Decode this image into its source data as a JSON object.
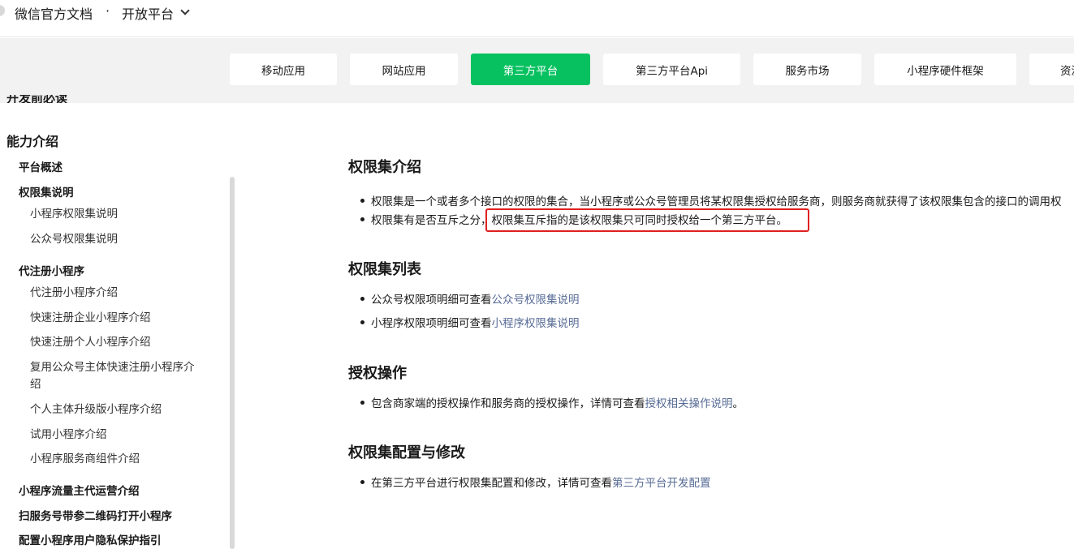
{
  "header": {
    "brand": "微信官方文档",
    "separator": "·",
    "platform_label": "开放平台"
  },
  "tabs": [
    {
      "label": "移动应用",
      "active": false
    },
    {
      "label": "网站应用",
      "active": false
    },
    {
      "label": "第三方平台",
      "active": true
    },
    {
      "label": "第三方平台Api",
      "active": false
    },
    {
      "label": "服务市场",
      "active": false
    },
    {
      "label": "小程序硬件框架",
      "active": false
    },
    {
      "label": "资源",
      "active": false
    }
  ],
  "sidebar": {
    "cut_item": "开发前必读",
    "items": [
      {
        "label": "能力介绍",
        "level": "h1"
      },
      {
        "label": "平台概述",
        "level": "h2"
      },
      {
        "label": "权限集说明",
        "level": "h2"
      },
      {
        "label": "小程序权限集说明",
        "level": "h3"
      },
      {
        "label": "公众号权限集说明",
        "level": "h3"
      },
      {
        "label": "代注册小程序",
        "level": "h2"
      },
      {
        "label": "代注册小程序介绍",
        "level": "h3"
      },
      {
        "label": "快速注册企业小程序介绍",
        "level": "h3"
      },
      {
        "label": "快速注册个人小程序介绍",
        "level": "h3"
      },
      {
        "label": "复用公众号主体快速注册小程序介",
        "level": "h3"
      },
      {
        "label": "绍",
        "level": "h3"
      },
      {
        "label": "个人主体升级版小程序介绍",
        "level": "h3"
      },
      {
        "label": "试用小程序介绍",
        "level": "h3"
      },
      {
        "label": "小程序服务商组件介绍",
        "level": "h3"
      },
      {
        "label": "小程序流量主代运营介绍",
        "level": "h2"
      },
      {
        "label": "扫服务号带参二维码打开小程序",
        "level": "h2"
      },
      {
        "label": "配置小程序用户隐私保护指引",
        "level": "h2"
      }
    ]
  },
  "content": {
    "sections": [
      {
        "title": "权限集介绍",
        "bullets": [
          {
            "text": "权限集是一个或者多个接口的权限的集合，当小程序或公众号管理员将某权限集授权给服务商，则服务商就获得了该权限集包含的接口的调用权",
            "link": ""
          },
          {
            "text": "权限集有是否互斥之分，权限集互斥指的是该权限集只可同时授权给一个第三方平台。",
            "link": ""
          }
        ]
      },
      {
        "title": "权限集列表",
        "bullets": [
          {
            "text": "公众号权限项明细可查看",
            "link": "公众号权限集说明"
          },
          {
            "text": "小程序权限项明细可查看",
            "link": "小程序权限集说明"
          }
        ]
      },
      {
        "title": "授权操作",
        "bullets": [
          {
            "text": "包含商家端的授权操作和服务商的授权操作，详情可查看",
            "link": "授权相关操作说明",
            "suffix": "。"
          }
        ]
      },
      {
        "title": "权限集配置与修改",
        "bullets": [
          {
            "text": "在第三方平台进行权限集配置和修改，详情可查看",
            "link": "第三方平台开发配置"
          }
        ]
      }
    ]
  },
  "colors": {
    "accent_green": "#07c160",
    "link_blue": "#576b95",
    "highlight_red": "#e02020",
    "tabstrip_bg": "#f2f2f2"
  }
}
